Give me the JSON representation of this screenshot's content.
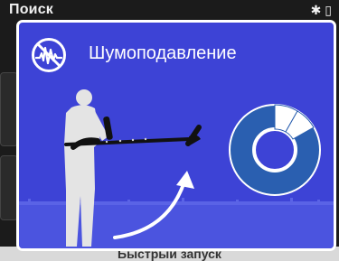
{
  "background": {
    "title": "Поиск",
    "status_icons": "✱ ▯",
    "bottom_button_label": "Быстрый запуск"
  },
  "modal": {
    "title": "Шумоподавление",
    "icon": "noise-cancel-icon",
    "colors": {
      "panel": "#3d43d6",
      "ground": "#4b54df",
      "figure": "#e4e4e4",
      "detector": "#111111",
      "ring": "#2a5fb0"
    },
    "noise_level_segments": {
      "total": 12,
      "highlighted": 2
    }
  }
}
